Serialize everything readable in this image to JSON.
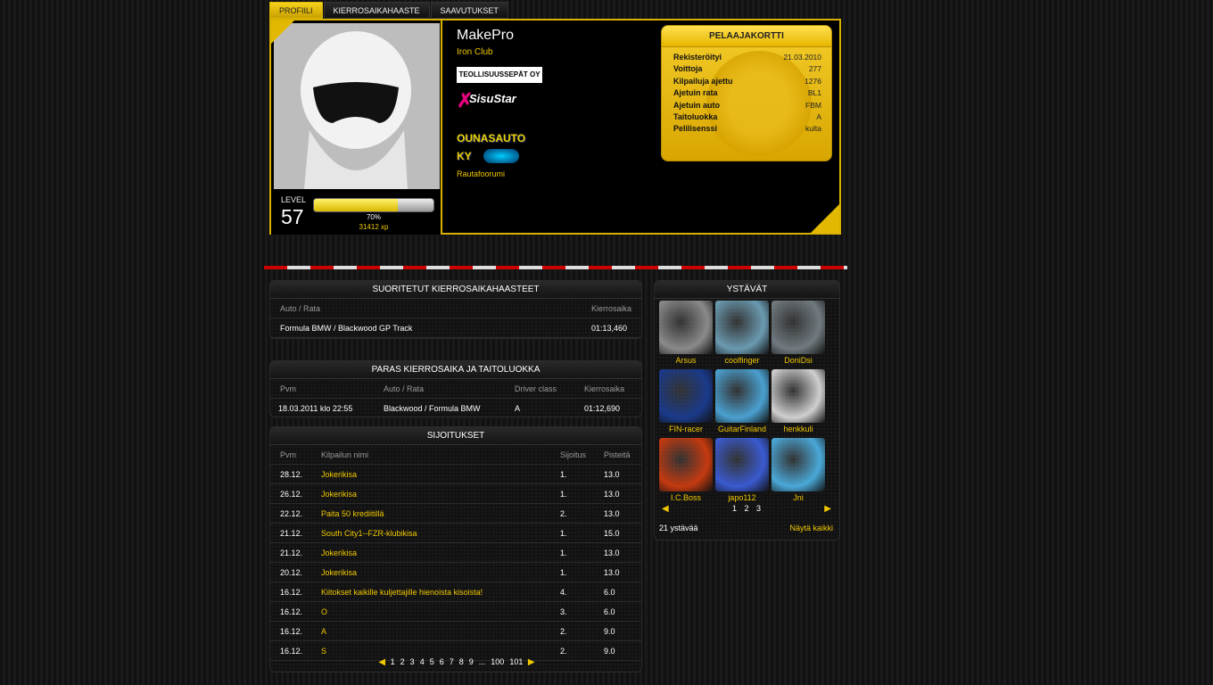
{
  "tabs": [
    "PROFIILI",
    "KIERROSAIKAHAASTE",
    "SAAVUTUKSET"
  ],
  "profile": {
    "name": "MakePro",
    "club": "Iron Club",
    "level_label": "LEVEL",
    "level": "57",
    "xp_progress": 0.7,
    "xp_percent": "70%",
    "xp_value": "31412 xp",
    "sponsors": [
      "TEOLLISUUSSEPÄT OY",
      "SisuStar",
      "OUNASAUTO KY"
    ],
    "rautafoorumi": "Rautafoorumi"
  },
  "card": {
    "title": "PELAAJAKORTTI",
    "rows": [
      {
        "k": "Rekisteröityi",
        "v": "21.03.2010"
      },
      {
        "k": "Voittoja",
        "v": "277"
      },
      {
        "k": "Kilpailuja ajettu",
        "v": "1276"
      },
      {
        "k": "Ajetuin rata",
        "v": "BL1"
      },
      {
        "k": "Ajetuin auto",
        "v": "FBM"
      },
      {
        "k": "Taitoluokka",
        "v": "A"
      },
      {
        "k": "Pelilisenssi",
        "v": "kulta"
      }
    ]
  },
  "challenges": {
    "title": "SUORITETUT KIERROSAIKAHAASTEET",
    "col1": "Auto / Rata",
    "col2": "Kierrosaika",
    "rows": [
      {
        "a": "Formula BMW / Blackwood GP Track",
        "t": "01:13,460"
      }
    ]
  },
  "best": {
    "title": "PARAS KIERROSAIKA JA TAITOLUOKKA",
    "cols": [
      "Pvm",
      "Auto / Rata",
      "Driver class",
      "Kierrosaika"
    ],
    "row": [
      "18.03.2011 klo 22:55",
      "Blackwood / Formula BMW",
      "A",
      "01:12,690"
    ]
  },
  "results": {
    "title": "SIJOITUKSET",
    "cols": [
      "Pvm",
      "Kilpailun nimi",
      "Sijoitus",
      "Pisteitä"
    ],
    "rows": [
      [
        "28.12.",
        "Jokerikisa",
        "1.",
        "13.0"
      ],
      [
        "26.12.",
        "Jokerikisa",
        "1.",
        "13.0"
      ],
      [
        "22.12.",
        "Paita 50 krediitillä",
        "2.",
        "13.0"
      ],
      [
        "21.12.",
        "South City1--FZR-klubikisa",
        "1.",
        "15.0"
      ],
      [
        "21.12.",
        "Jokerikisa",
        "1.",
        "13.0"
      ],
      [
        "20.12.",
        "Jokerikisa",
        "1.",
        "13.0"
      ],
      [
        "16.12.",
        "Kiitokset kaikille kuljettajille hienoista kisoista!",
        "4.",
        "6.0"
      ],
      [
        "16.12.",
        "O",
        "3.",
        "6.0"
      ],
      [
        "16.12.",
        "A",
        "2.",
        "9.0"
      ],
      [
        "16.12.",
        "S",
        "2.",
        "9.0"
      ]
    ],
    "pages": [
      "1",
      "2",
      "3",
      "4",
      "5",
      "6",
      "7",
      "8",
      "9",
      "...",
      "100",
      "101"
    ]
  },
  "friends": {
    "title": "YSTÄVÄT",
    "list": [
      {
        "name": "Arsus",
        "color": "#8a8a8a"
      },
      {
        "name": "coolfinger",
        "color": "#6a9ab0"
      },
      {
        "name": "DoniDsi",
        "color": "#707a80"
      },
      {
        "name": "FIN-racer",
        "color": "#1a3a8a"
      },
      {
        "name": "GuitarFinland",
        "color": "#4aa0d0"
      },
      {
        "name": "henkkuli",
        "color": "#cfcfcf"
      },
      {
        "name": "I.C.Boss",
        "color": "#c43a10"
      },
      {
        "name": "japo112",
        "color": "#3a5ad0"
      },
      {
        "name": "Jni",
        "color": "#4aa8d8"
      }
    ],
    "pages": [
      "1",
      "2",
      "3"
    ],
    "count": "21 ystävää",
    "show_all": "Näytä kaikki"
  }
}
